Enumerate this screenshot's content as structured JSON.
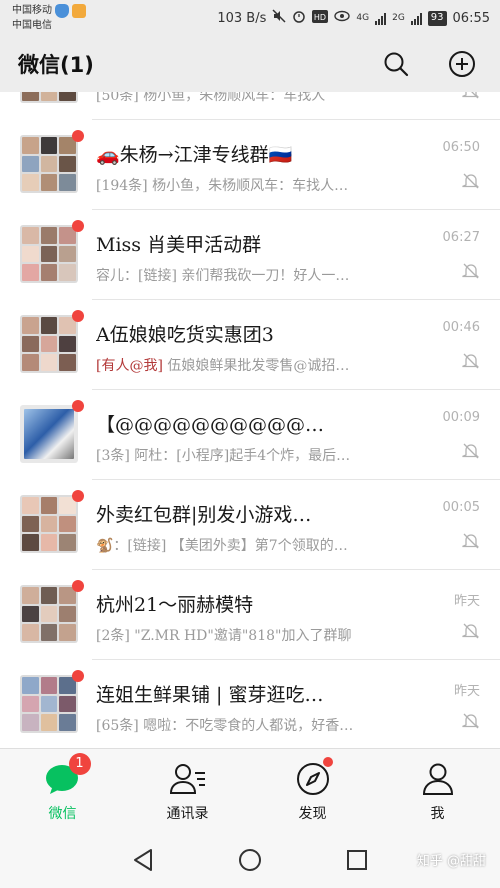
{
  "status_bar": {
    "carrier_1": "中国移动",
    "carrier_2": "中国电信",
    "speed": "103 B/s",
    "net_1": "4G",
    "net_2": "2G",
    "battery": "93",
    "time": "06:55"
  },
  "header": {
    "title": "微信(1)",
    "search_icon": "search-icon",
    "add_icon": "plus-circle-icon"
  },
  "chats": [
    {
      "name": "",
      "preview": "[50条] 杨小鱼，朱杨顺风车：车找人",
      "time": "",
      "muted": true,
      "unread_dot": false,
      "partial": true
    },
    {
      "name": "🚗朱杨→江津专线群🇷🇺",
      "preview": "[194条] 杨小鱼，朱杨顺风车：车找人…",
      "time": "06:50",
      "muted": true,
      "unread_dot": true
    },
    {
      "name": "Miss 肖美甲活动群",
      "preview": "容儿：[链接] 亲们帮我砍一刀！好人一…",
      "time": "06:27",
      "muted": true,
      "unread_dot": true
    },
    {
      "name": "A伍娘娘吃货实惠团3",
      "preview_mention": "[有人@我]",
      "preview": " 伍娘娘鲜果批发零售@诚招…",
      "time": "00:46",
      "muted": true,
      "unread_dot": true
    },
    {
      "name": "【@@@@@@@@@@…",
      "preview": "[3条] 阿杜：[小程序]起手4个炸，最后…",
      "time": "00:09",
      "muted": true,
      "unread_dot": true
    },
    {
      "name": "外卖红包群|别发小游戏…",
      "preview": "🐒：[链接] 【美团外卖】第7个领取的…",
      "time": "00:05",
      "muted": true,
      "unread_dot": true
    },
    {
      "name": "杭州21～丽赫模特",
      "preview": "[2条] \"Z.MR HD\"邀请\"818\"加入了群聊",
      "time": "昨天",
      "muted": true,
      "unread_dot": true
    },
    {
      "name": "连姐生鲜果铺 | 蜜芽逛吃…",
      "preview": "[65条] 嗯啦：不吃零食的人都说，好香…",
      "time": "昨天",
      "muted": true,
      "unread_dot": true
    }
  ],
  "tabbar": {
    "chats": {
      "label": "微信",
      "badge": "1",
      "icon": "chat-bubble-icon"
    },
    "contacts": {
      "label": "通讯录",
      "icon": "contacts-icon"
    },
    "discover": {
      "label": "发现",
      "icon": "compass-icon"
    },
    "me": {
      "label": "我",
      "icon": "person-icon"
    }
  },
  "watermark": "知乎 @甜甜",
  "colors": {
    "accent": "#07c160",
    "badge": "#f0443e",
    "background": "#ededed"
  }
}
